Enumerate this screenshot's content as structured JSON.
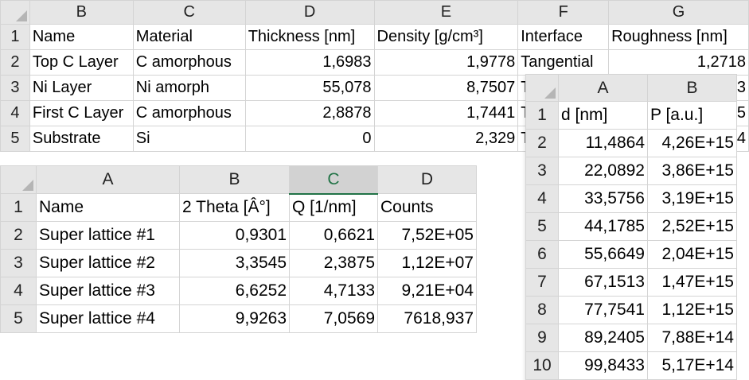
{
  "sheet1": {
    "col_headers": [
      "B",
      "C",
      "D",
      "E",
      "F",
      "G"
    ],
    "rows": [
      {
        "n": "1",
        "cells": [
          "Name",
          "Material",
          "Thickness [nm]",
          "Density [g/cm³]",
          "Interface",
          "Roughness [nm]"
        ]
      },
      {
        "n": "2",
        "cells": [
          "Top C Layer",
          "C amorphous",
          "1,6983",
          "1,9778",
          "Tangential",
          "1,2718"
        ]
      },
      {
        "n": "3",
        "cells": [
          "Ni Layer",
          "Ni amorph",
          "55,078",
          "8,7507",
          "T",
          "3"
        ]
      },
      {
        "n": "4",
        "cells": [
          "First C Layer",
          "C amorphous",
          "2,8878",
          "1,7441",
          "T",
          "5"
        ]
      },
      {
        "n": "5",
        "cells": [
          "Substrate",
          "Si",
          "0",
          "2,329",
          "T",
          "4"
        ]
      }
    ]
  },
  "sheet2": {
    "col_headers": [
      "A",
      "B",
      "C",
      "D"
    ],
    "selected_col": "C",
    "rows": [
      {
        "n": "1",
        "cells": [
          "Name",
          "2 Theta [Â°]",
          "Q [1/nm]",
          "Counts"
        ]
      },
      {
        "n": "2",
        "cells": [
          "Super lattice #1",
          "0,9301",
          "0,6621",
          "7,52E+05"
        ]
      },
      {
        "n": "3",
        "cells": [
          "Super lattice #2",
          "3,3545",
          "2,3875",
          "1,12E+07"
        ]
      },
      {
        "n": "4",
        "cells": [
          "Super lattice #3",
          "6,6252",
          "4,7133",
          "9,21E+04"
        ]
      },
      {
        "n": "5",
        "cells": [
          "Super lattice #4",
          "9,9263",
          "7,0569",
          "7618,937"
        ]
      }
    ]
  },
  "sheet3": {
    "col_headers": [
      "A",
      "B"
    ],
    "rows": [
      {
        "n": "1",
        "cells": [
          "d [nm]",
          "P [a.u.]"
        ]
      },
      {
        "n": "2",
        "cells": [
          "11,4864",
          "4,26E+15"
        ]
      },
      {
        "n": "3",
        "cells": [
          "22,0892",
          "3,86E+15"
        ]
      },
      {
        "n": "4",
        "cells": [
          "33,5756",
          "3,19E+15"
        ]
      },
      {
        "n": "5",
        "cells": [
          "44,1785",
          "2,52E+15"
        ]
      },
      {
        "n": "6",
        "cells": [
          "55,6649",
          "2,04E+15"
        ]
      },
      {
        "n": "7",
        "cells": [
          "67,1513",
          "1,47E+15"
        ]
      },
      {
        "n": "8",
        "cells": [
          "77,7541",
          "1,12E+15"
        ]
      },
      {
        "n": "9",
        "cells": [
          "89,2405",
          "7,88E+14"
        ]
      },
      {
        "n": "10",
        "cells": [
          "99,8433",
          "5,17E+14"
        ]
      }
    ]
  }
}
